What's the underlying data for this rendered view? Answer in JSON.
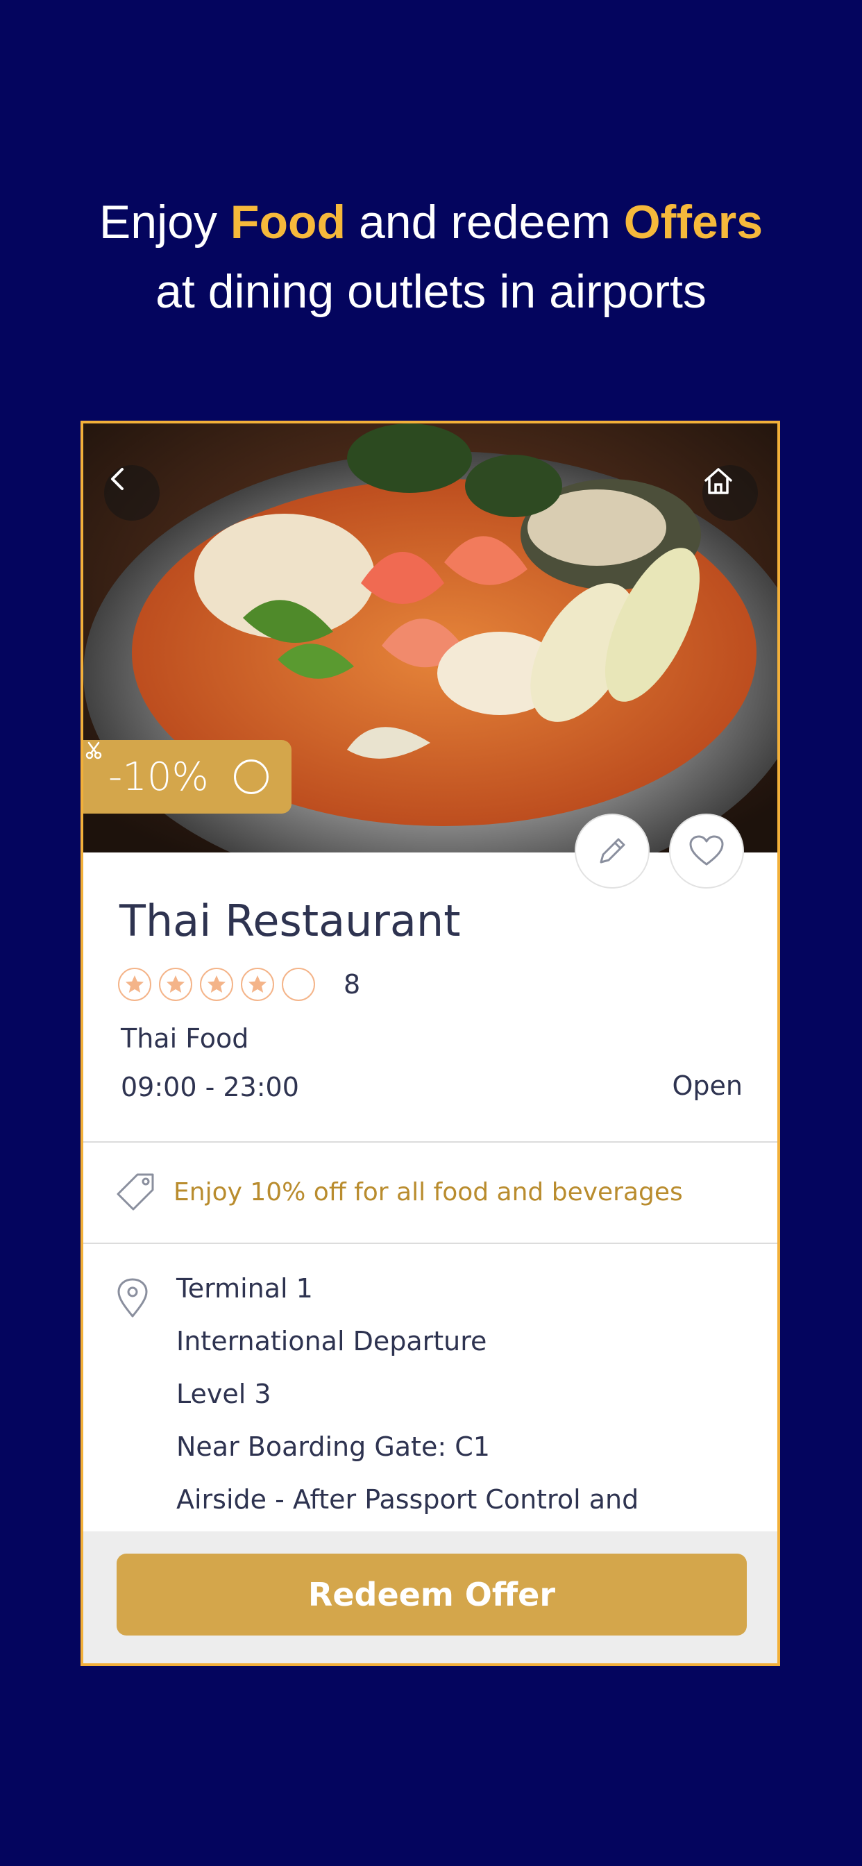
{
  "headline": {
    "line1_prefix": "Enjoy ",
    "line1_highlight1": "Food",
    "line1_middle": " and redeem ",
    "line1_highlight2": "Offers",
    "line2": "at dining outlets in airports"
  },
  "colors": {
    "background": "#04055e",
    "accent": "#f6b93b",
    "gold": "#d4a64b",
    "card_border": "#f2b03a",
    "text_dark": "#2e3350"
  },
  "card": {
    "image_alt": "seafood hot pot photo",
    "back_icon": "chevron-left-icon",
    "home_icon": "home-icon",
    "discount_label": "-10%",
    "discount_icon": "scissors-icon",
    "edit_icon": "pencil-icon",
    "favorite_icon": "heart-icon",
    "restaurant_name": "Thai Restaurant",
    "rating": {
      "stars_filled": 4,
      "stars_total": 5,
      "count": "8"
    },
    "cuisine": "Thai Food",
    "hours": "09:00 - 23:00",
    "status": "Open",
    "offer_icon": "tag-icon",
    "offer_text": "Enjoy 10% off for all food and beverages",
    "location_icon": "map-pin-icon",
    "location_lines": [
      "Terminal 1",
      "International Departure",
      "Level 3",
      "Near Boarding Gate: C1",
      "Airside - After Passport Control and"
    ],
    "redeem_label": "Redeem Offer"
  }
}
